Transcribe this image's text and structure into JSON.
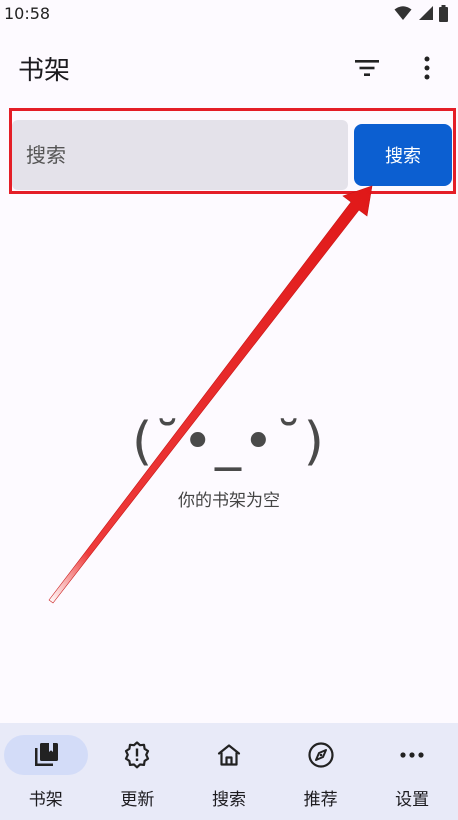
{
  "status_bar": {
    "time": "10:58",
    "icons": [
      "wifi-icon",
      "signal-icon",
      "battery-icon"
    ]
  },
  "app_bar": {
    "title": "书架",
    "actions": [
      "filter-icon",
      "more-vert-icon"
    ]
  },
  "search": {
    "placeholder": "搜索",
    "value": "",
    "button_label": "搜索"
  },
  "empty_state": {
    "face": "(˘•_•˘)",
    "message": "你的书架为空"
  },
  "bottom_nav": {
    "items": [
      {
        "label": "书架",
        "icon": "library-books-icon",
        "active": true
      },
      {
        "label": "更新",
        "icon": "update-badge-icon",
        "active": false
      },
      {
        "label": "搜索",
        "icon": "home-icon",
        "active": false
      },
      {
        "label": "推荐",
        "icon": "compass-icon",
        "active": false
      },
      {
        "label": "设置",
        "icon": "more-horiz-icon",
        "active": false
      }
    ]
  },
  "colors": {
    "accent": "#0c5fd1",
    "annotation": "#e41e27",
    "nav_background": "#e8eaf8",
    "nav_active_pill": "#d3dcf8",
    "input_background": "#e4e2ea"
  }
}
